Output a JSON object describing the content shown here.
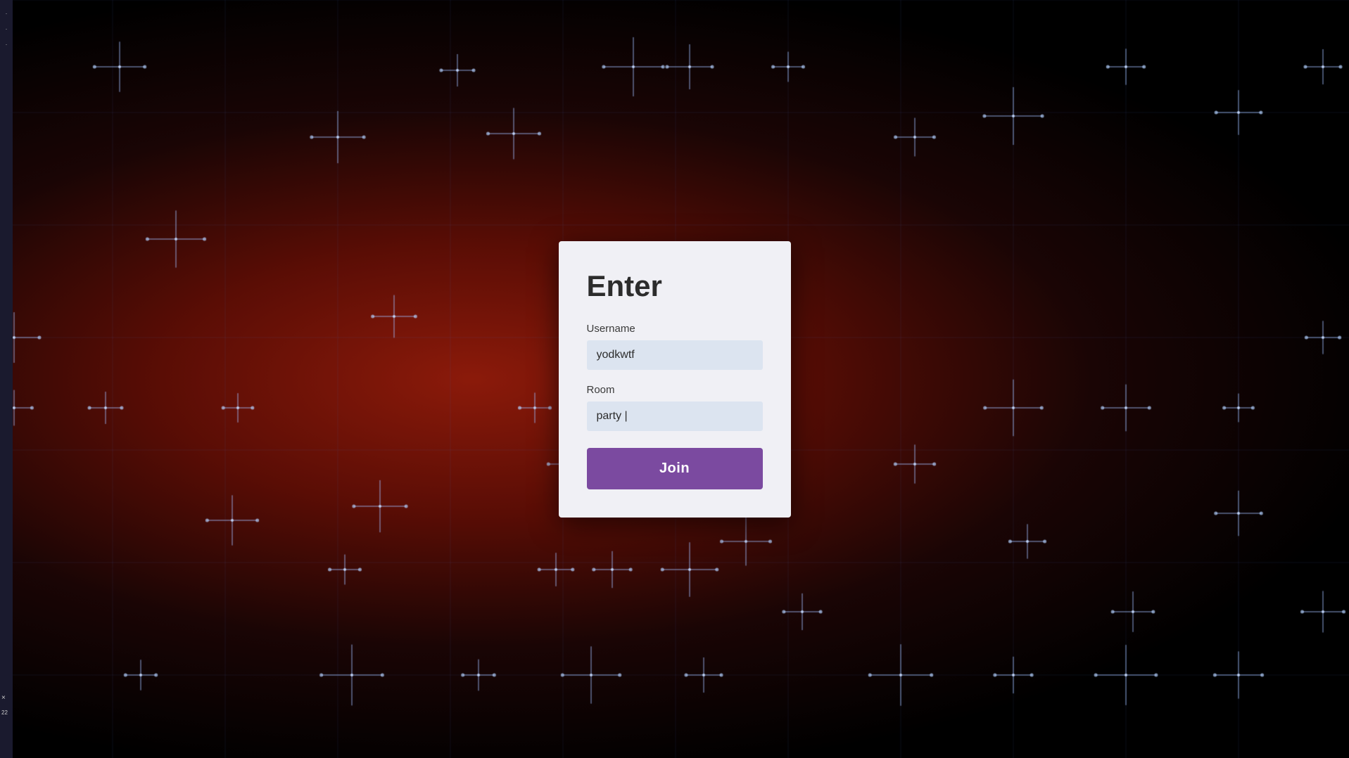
{
  "background": {
    "color_primary": "#000000",
    "color_accent": "#8b1a0a"
  },
  "taskbar": {
    "close_label": "×",
    "number_label": "22"
  },
  "dialog": {
    "title": "Enter",
    "username_label": "Username",
    "username_value": "yodkwtf",
    "room_label": "Room",
    "room_value": "party |",
    "join_button_label": "Join"
  }
}
